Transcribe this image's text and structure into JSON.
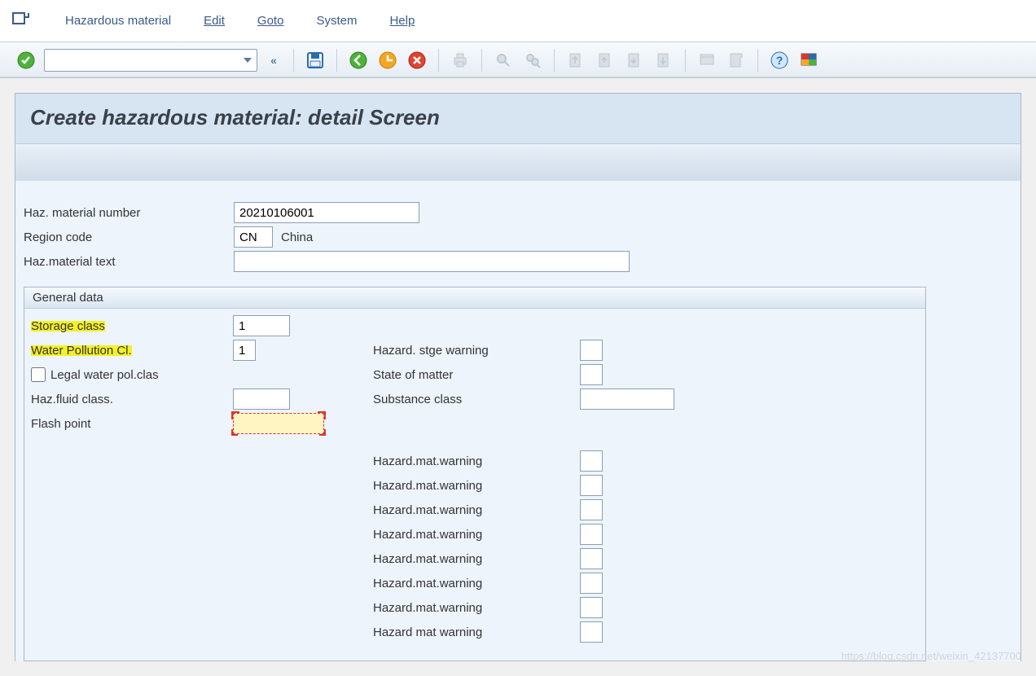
{
  "menu": {
    "hazmat": "Hazardous material",
    "edit": "Edit",
    "goto": "Goto",
    "system": "System",
    "help": "Help"
  },
  "title": "Create hazardous material: detail Screen",
  "header": {
    "haz_number_label": "Haz. material number",
    "haz_number_value": "20210106001",
    "region_code_label": "Region code",
    "region_code_value": "CN",
    "region_code_name": "China",
    "haz_text_label": "Haz.material text",
    "haz_text_value": ""
  },
  "group": {
    "title": "General data",
    "left": {
      "storage_class_label": "Storage class",
      "storage_class_value": "1",
      "water_pollution_label": "Water Pollution Cl.",
      "water_pollution_value": "1",
      "legal_water_label": "Legal water pol.clas",
      "haz_fluid_label": "Haz.fluid class.",
      "haz_fluid_value": "",
      "flash_point_label": "Flash point",
      "flash_point_value": ""
    },
    "right": {
      "hazard_stge_label": "Hazard. stge warning",
      "hazard_stge_value": "",
      "state_matter_label": "State of matter",
      "state_matter_value": "",
      "substance_class_label": "Substance class",
      "substance_class_value": "",
      "warnings": [
        "Hazard.mat.warning",
        "Hazard.mat.warning",
        "Hazard.mat.warning",
        "Hazard.mat.warning",
        "Hazard.mat.warning",
        "Hazard.mat.warning",
        "Hazard.mat.warning",
        "Hazard mat warning"
      ]
    }
  },
  "watermark": "https://blog.csdn.net/weixin_42137700"
}
